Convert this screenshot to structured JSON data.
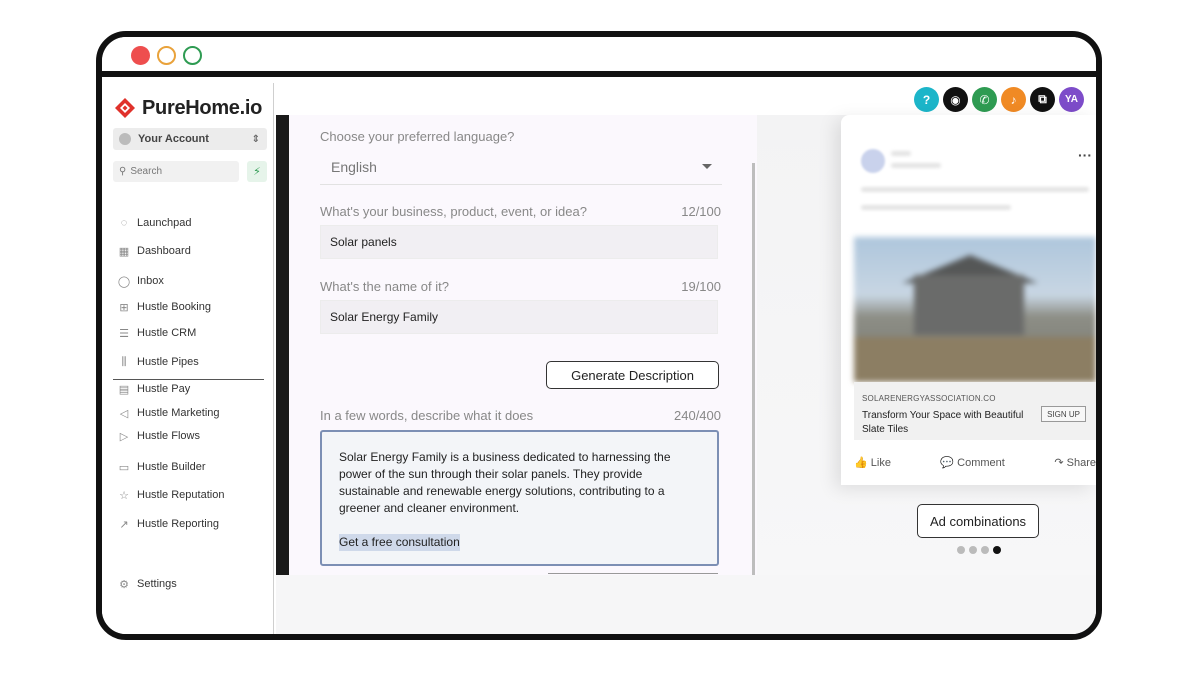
{
  "window": {
    "brand": "PureHome.io"
  },
  "sidebar": {
    "account_label": "Your Account",
    "search_placeholder": "Search",
    "items": [
      {
        "label": "Launchpad",
        "icon": "rocket-icon"
      },
      {
        "label": "Dashboard",
        "icon": "dashboard-icon"
      },
      {
        "label": "Inbox",
        "icon": "chat-icon"
      },
      {
        "label": "Hustle Booking",
        "icon": "calendar-icon"
      },
      {
        "label": "Hustle CRM",
        "icon": "list-icon"
      },
      {
        "label": "Hustle Pipes",
        "icon": "pipes-icon"
      },
      {
        "label": "Hustle Pay",
        "icon": "invoice-icon"
      },
      {
        "label": "Hustle Marketing",
        "icon": "send-icon"
      },
      {
        "label": "Hustle Flows",
        "icon": "play-icon"
      },
      {
        "label": "Hustle Builder",
        "icon": "builder-icon"
      },
      {
        "label": "Hustle Reputation",
        "icon": "star-icon"
      },
      {
        "label": "Hustle Reporting",
        "icon": "trend-icon"
      }
    ],
    "settings_label": "Settings"
  },
  "topbar": {
    "avatar_initials": "YA",
    "colors": {
      "help": "#1cb5c9",
      "bot": "#111111",
      "phone": "#2e9b52",
      "bell": "#f08a24",
      "translate": "#111111",
      "avatar": "#7d4cc9"
    }
  },
  "form": {
    "language_label": "Choose your preferred language?",
    "language_value": "English",
    "business_label": "What's your business, product, event, or idea?",
    "business_counter": "12/100",
    "business_value": "Solar panels",
    "name_label": "What's the name of it?",
    "name_counter": "19/100",
    "name_value": "Solar Energy Family",
    "generate_label": "Generate Description",
    "describe_label": "In a few words, describe what it does",
    "describe_counter": "240/400",
    "description": "Solar Energy Family is a business dedicated to harnessing the power of the sun through their solar panels. They provide sustainable and renewable energy solutions, contributing to a greener and cleaner environment.",
    "cta": "Get a free consultation"
  },
  "preview": {
    "domain": "SOLARENERGYASSOCIATION.CO",
    "headline": "Transform Your Space with Beautiful Slate Tiles",
    "signup": "SIGN UP",
    "like": "Like",
    "comment": "Comment",
    "share": "Share",
    "ad_combinations": "Ad combinations",
    "pager": {
      "count": 4,
      "active": 4
    }
  }
}
